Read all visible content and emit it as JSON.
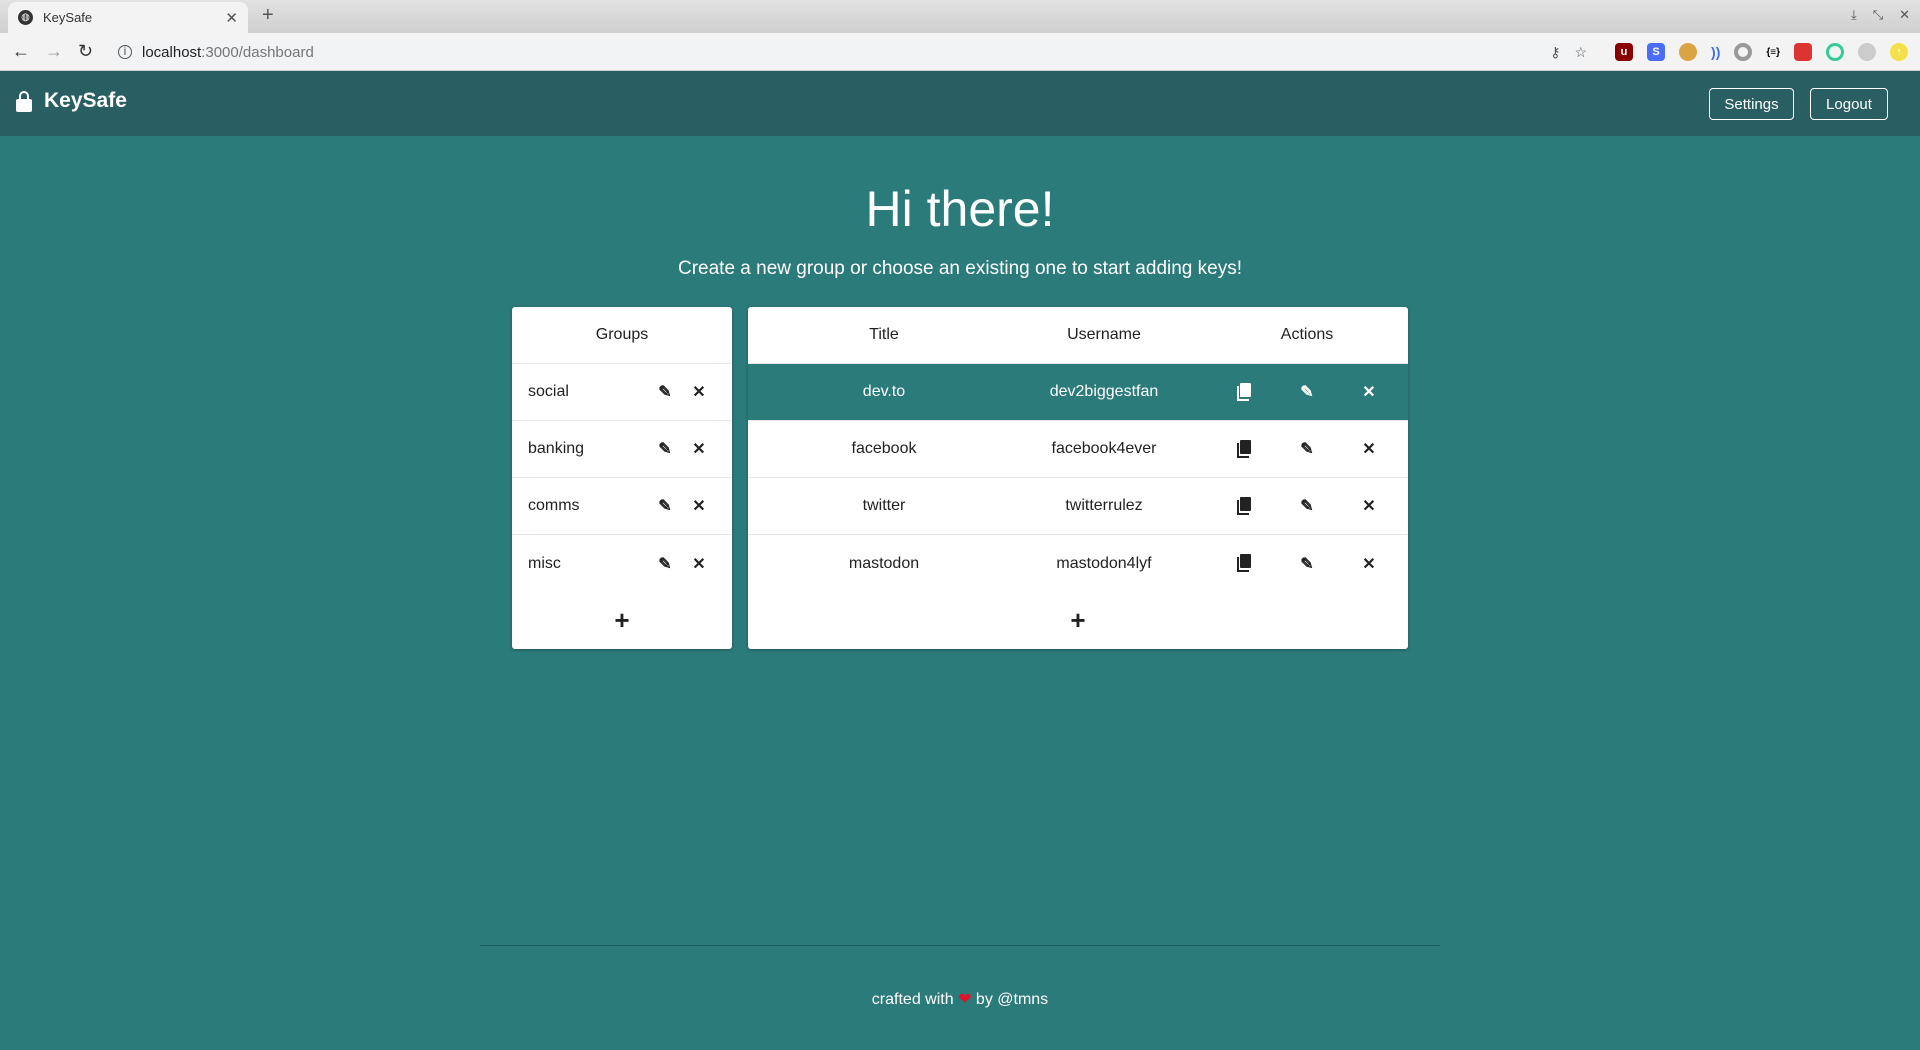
{
  "browser": {
    "tab_title": "KeySafe",
    "url_host": "localhost",
    "url_path": ":3000/dashboard"
  },
  "navbar": {
    "brand": "KeySafe",
    "settings": "Settings",
    "logout": "Logout"
  },
  "main": {
    "title": "Hi there!",
    "subtitle": "Create a new group or choose an existing one to start adding keys!"
  },
  "groups": {
    "header": "Groups",
    "items": [
      {
        "name": "social"
      },
      {
        "name": "banking"
      },
      {
        "name": "comms"
      },
      {
        "name": "misc"
      }
    ],
    "add": "+"
  },
  "keys": {
    "headers": {
      "title": "Title",
      "username": "Username",
      "actions": "Actions"
    },
    "rows": [
      {
        "title": "dev.to",
        "username": "dev2biggestfan",
        "selected": true
      },
      {
        "title": "facebook",
        "username": "facebook4ever"
      },
      {
        "title": "twitter",
        "username": "twitterrulez"
      },
      {
        "title": "mastodon",
        "username": "mastodon4lyf"
      }
    ],
    "add": "+"
  },
  "footer": {
    "pre": "crafted with",
    "heart": "❤",
    "post": "by @tmns"
  },
  "colors": {
    "navbar": "#295f62",
    "background": "#2c7b7b",
    "heart": "#e3102c"
  }
}
